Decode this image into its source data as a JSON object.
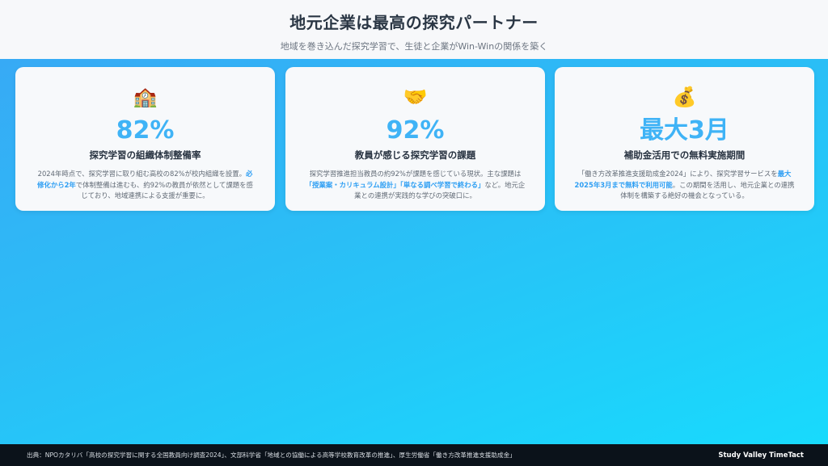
{
  "header": {
    "title": "地元企業は最高の探究パートナー",
    "subtitle": "地域を巻き込んだ探究学習で、生徒と企業がWin-Winの関係を築く"
  },
  "cards": [
    {
      "icon": "school-building-icon",
      "icon_glyph": "🏫",
      "stat": "82%",
      "label": "探究学習の組織体制整備率",
      "desc_pre": "2024年時点で、探究学習に取り組む高校の82%が校内組織を設置。",
      "desc_hl": "必修化から2年",
      "desc_post": "で体制整備は進むも、約92%の教員が依然として課題を感じており、地域連携による支援が重要に。"
    },
    {
      "icon": "handshake-icon",
      "icon_glyph": "🤝",
      "stat": "92%",
      "label": "教員が感じる探究学習の課題",
      "desc_pre": "探究学習推進担当教員の約92%が課題を感じている現状。主な課題は",
      "desc_hl": "「授業案・カリキュラム設計」「単なる調べ学習で終わる」",
      "desc_post": "など。地元企業との連携が実践的な学びの突破口に。"
    },
    {
      "icon": "money-bag-icon",
      "icon_glyph": "💰",
      "stat": "最大3月",
      "label": "補助金活用での無料実施期間",
      "desc_pre": "「働き方改革推進支援助成金2024」により、探究学習サービスを",
      "desc_hl": "最大2025年3月まで無料で利用可能",
      "desc_post": "。この期間を活用し、地元企業との連携体制を構築する絶好の機会となっている。"
    }
  ],
  "footer": {
    "source": "出典：NPOカタリバ「高校の探究学習に関する全国教員向け調査2024」、文部科学省「地域との協働による高等学校教育改革の推進」、厚生労働省「働き方改革推進支援助成金」",
    "brand": "Study Valley TimeTact"
  }
}
